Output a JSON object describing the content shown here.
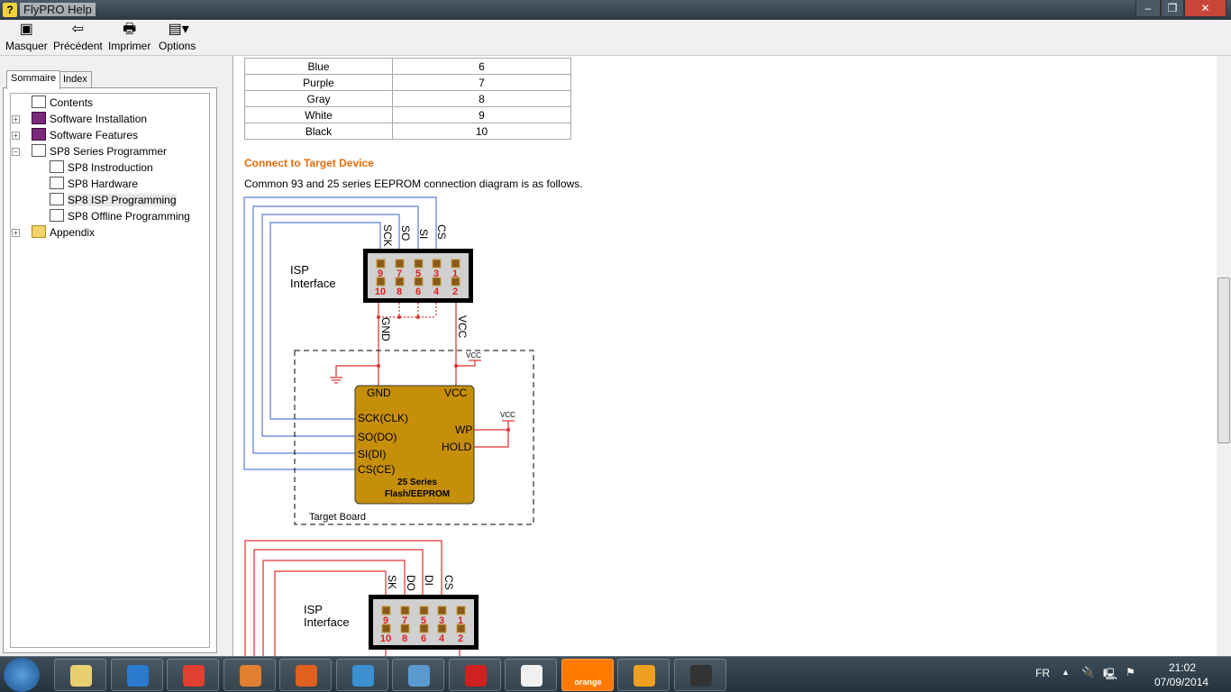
{
  "window": {
    "title": "FlyPRO Help",
    "controls": {
      "minimize": "–",
      "maximize": "❐",
      "close": "✕"
    }
  },
  "toolbar": {
    "items": [
      {
        "label": "Masquer",
        "icon": "hide-pane-icon"
      },
      {
        "label": "Précédent",
        "icon": "back-arrow-icon"
      },
      {
        "label": "Imprimer",
        "icon": "printer-icon"
      },
      {
        "label": "Options",
        "icon": "options-icon"
      }
    ]
  },
  "nav": {
    "tabs": [
      "Sommaire",
      "Index"
    ],
    "tree": [
      {
        "label": "Contents",
        "icon": "book-open"
      },
      {
        "label": "Software Installation",
        "icon": "book",
        "expander": "+"
      },
      {
        "label": "Software Features",
        "icon": "book",
        "expander": "+"
      },
      {
        "label": "SP8 Series Programmer",
        "icon": "book-open",
        "expander": "−"
      },
      {
        "label": "SP8 Instroduction",
        "icon": "page"
      },
      {
        "label": "SP8 Hardware",
        "icon": "page"
      },
      {
        "label": "SP8 ISP Programming",
        "icon": "page",
        "selected": true
      },
      {
        "label": "SP8 Offline Programming",
        "icon": "page"
      },
      {
        "label": "Appendix",
        "icon": "folder",
        "expander": "+"
      }
    ]
  },
  "content": {
    "color_table": [
      [
        "Blue",
        "6"
      ],
      [
        "Purple",
        "7"
      ],
      [
        "Gray",
        "8"
      ],
      [
        "White",
        "9"
      ],
      [
        "Black",
        "10"
      ]
    ],
    "section_title": "Connect to Target Device",
    "section_text": "Common 93 and 25 series EEPROM connection diagram is as follows.",
    "diagram1": {
      "isp_label1": "ISP",
      "isp_label2": "Interface",
      "signals": [
        "SCK",
        "SO",
        "SI",
        "CS"
      ],
      "top_pins": [
        "9",
        "7",
        "5",
        "3",
        "1"
      ],
      "bottom_pins": [
        "10",
        "8",
        "6",
        "4",
        "2"
      ],
      "gnd": "GND",
      "vcc": "VCC",
      "chip_pins_left": [
        "SCK(CLK)",
        "SO(DO)",
        "SI(DI)",
        "CS(CE)"
      ],
      "chip_pins_right": [
        "WP",
        "HOLD"
      ],
      "chip_name1": "25 Series",
      "chip_name2": "Flash/EEPROM",
      "board": "Target Board",
      "chip_color": "#c68f0a"
    },
    "diagram2": {
      "isp_label1": "ISP",
      "isp_label2": "Interface",
      "signals": [
        "SK",
        "DO",
        "DI",
        "CS"
      ],
      "top_pins": [
        "9",
        "7",
        "5",
        "3",
        "1"
      ],
      "bottom_pins": [
        "10",
        "8",
        "6",
        "4",
        "2"
      ]
    }
  },
  "taskbar": {
    "language": "FR",
    "time": "21:02",
    "date": "07/09/2014",
    "apps": [
      "explorer",
      "internet-explorer",
      "chrome",
      "media-player",
      "firefox",
      "ccleaner",
      "control-panel",
      "acrobat",
      "flypro-help",
      "orange",
      "nero",
      "chip-programmer"
    ],
    "orange_label": "orange"
  }
}
